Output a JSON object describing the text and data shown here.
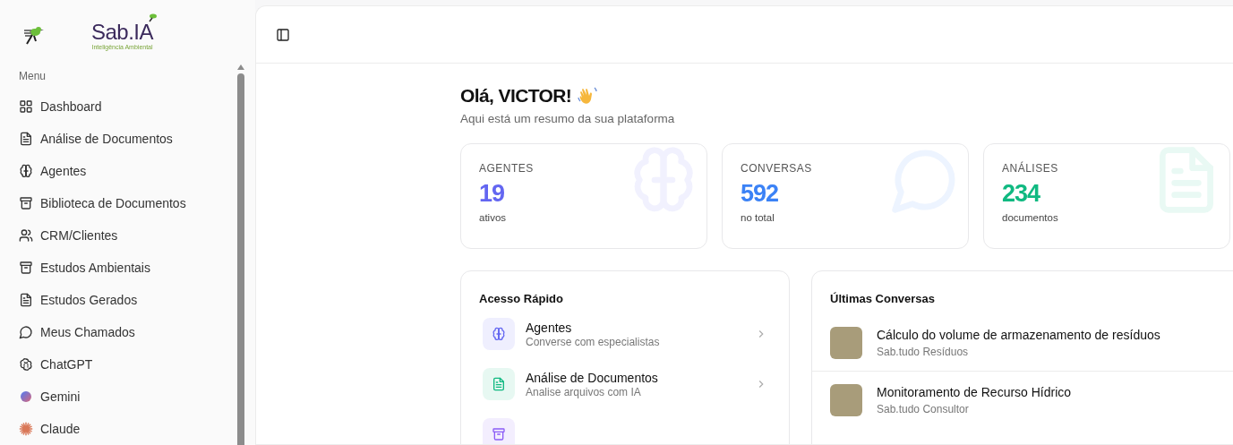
{
  "sidebar": {
    "logo": {
      "name": "Sab.IA",
      "tagline": "Inteligência Ambiental"
    },
    "section_label": "Menu",
    "items": [
      {
        "label": "Dashboard",
        "kind": "grid"
      },
      {
        "label": "Análise de Documentos",
        "kind": "document"
      },
      {
        "label": "Agentes",
        "kind": "brain"
      },
      {
        "label": "Biblioteca de Documentos",
        "kind": "archive"
      },
      {
        "label": "CRM/Clientes",
        "kind": "users"
      },
      {
        "label": "Estudos Ambientais",
        "kind": "archive"
      },
      {
        "label": "Estudos Gerados",
        "kind": "document"
      },
      {
        "label": "Meus Chamados",
        "kind": "chat"
      },
      {
        "label": "ChatGPT",
        "kind": "openai"
      },
      {
        "label": "Gemini",
        "kind": "gemini"
      },
      {
        "label": "Claude",
        "kind": "claude"
      }
    ]
  },
  "greeting": {
    "title": "Olá, VICTOR!",
    "subtitle": "Aqui está um resumo da sua plataforma"
  },
  "stats": [
    {
      "label": "AGENTES",
      "value": "19",
      "caption": "ativos",
      "kind": "brain",
      "color": "#6366f1"
    },
    {
      "label": "CONVERSAS",
      "value": "592",
      "caption": "no total",
      "kind": "chat",
      "color": "#3b82f6"
    },
    {
      "label": "ANÁLISES",
      "value": "234",
      "caption": "documentos",
      "kind": "document",
      "color": "#10b981"
    }
  ],
  "quick_access": {
    "title": "Acesso Rápido",
    "items": [
      {
        "title": "Agentes",
        "subtitle": "Converse com especialistas",
        "kind": "brain",
        "color": "#6366f1"
      },
      {
        "title": "Análise de Documentos",
        "subtitle": "Analise arquivos com IA",
        "kind": "document",
        "color": "#10b981"
      },
      {
        "kind": "archive",
        "color": "#8b5cf6"
      }
    ]
  },
  "recent_conversations": {
    "title": "Últimas Conversas",
    "items": [
      {
        "title": "Cálculo do volume de armazenamento de resíduos",
        "agent": "Sab.tudo Resíduos"
      },
      {
        "title": "Monitoramento de Recurso Hídrico",
        "agent": "Sab.tudo Consultor"
      }
    ]
  }
}
